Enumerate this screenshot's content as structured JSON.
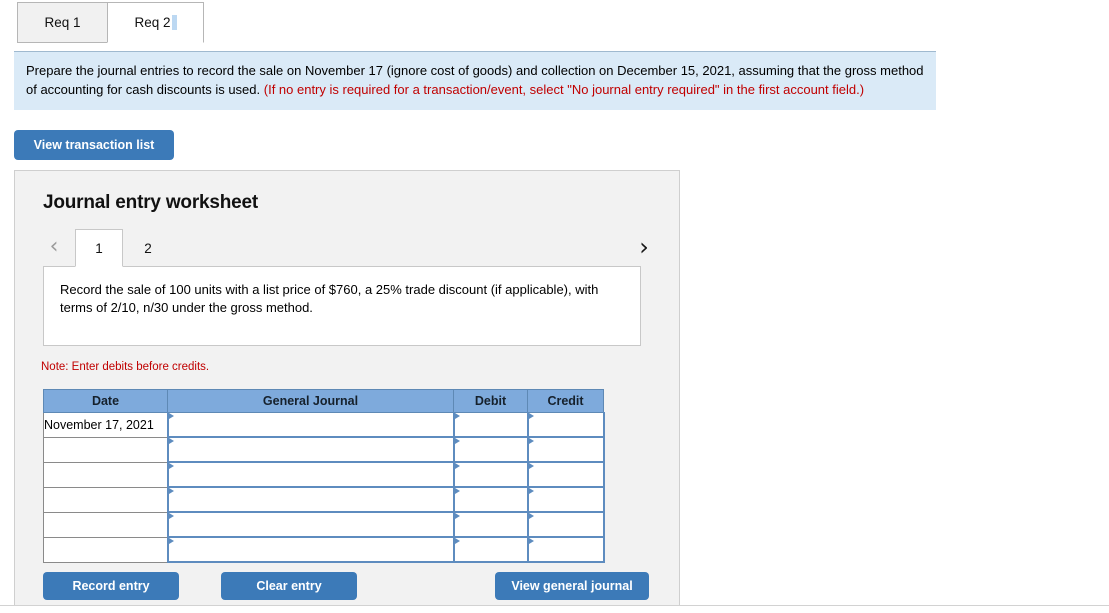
{
  "requirement_tabs": [
    {
      "label": "Req 1",
      "active": false
    },
    {
      "label": "Req 2",
      "active": true
    }
  ],
  "instruction": {
    "black_text": "Prepare the journal entries to record the sale on November 17 (ignore cost of goods) and collection on December 15, 2021, assuming that the gross method of accounting for cash discounts is used. ",
    "red_text": "(If no entry is required for a transaction/event, select \"No journal entry required\" in the first account field.)"
  },
  "toolbar": {
    "view_transaction_list_label": "View transaction list"
  },
  "worksheet": {
    "title": "Journal entry worksheet",
    "pager": {
      "prev_icon": "chevron-left-icon",
      "next_icon": "chevron-right-icon",
      "tabs": [
        {
          "label": "1",
          "active": true
        },
        {
          "label": "2",
          "active": false
        }
      ]
    },
    "task_text": "Record the sale of 100 units with a list price of $760, a 25% trade discount (if applicable), with terms of 2/10, n/30 under the gross method.",
    "note": "Note: Enter debits before credits.",
    "table": {
      "columns": [
        "Date",
        "General Journal",
        "Debit",
        "Credit"
      ],
      "rows": [
        {
          "date": "November 17, 2021",
          "general_journal": "",
          "debit": "",
          "credit": ""
        },
        {
          "date": "",
          "general_journal": "",
          "debit": "",
          "credit": ""
        },
        {
          "date": "",
          "general_journal": "",
          "debit": "",
          "credit": ""
        },
        {
          "date": "",
          "general_journal": "",
          "debit": "",
          "credit": ""
        },
        {
          "date": "",
          "general_journal": "",
          "debit": "",
          "credit": ""
        },
        {
          "date": "",
          "general_journal": "",
          "debit": "",
          "credit": ""
        }
      ]
    },
    "actions": {
      "record_entry_label": "Record entry",
      "clear_entry_label": "Clear entry",
      "view_general_journal_label": "View general journal"
    }
  },
  "colors": {
    "button_blue": "#3c7ab8",
    "table_header_blue": "#7eaadc",
    "banner_blue": "#daeaf7",
    "note_red": "#c00000",
    "cell_border_blue": "#5e8cbf"
  }
}
